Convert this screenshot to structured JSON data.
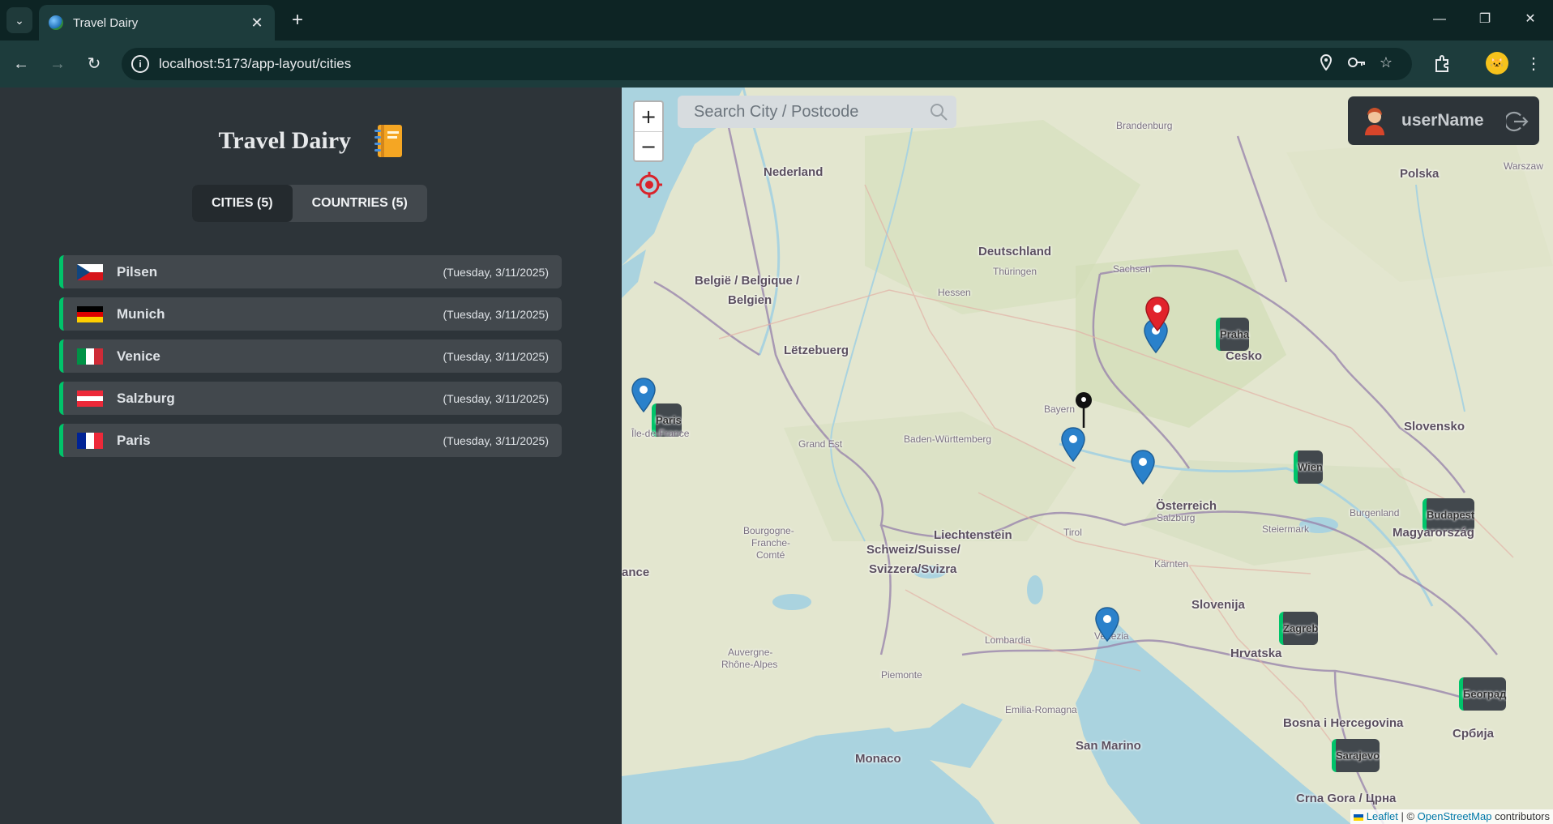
{
  "browser": {
    "tab_title": "Travel Dairy",
    "url": "localhost:5173/app-layout/cities"
  },
  "app": {
    "title": "Travel Dairy",
    "tabs": [
      {
        "label": "CITIES (5)"
      },
      {
        "label": "COUNTRIES (5)"
      }
    ],
    "cities": [
      {
        "name": "Pilsen",
        "date": "(Tuesday, 3/11/2025)",
        "flag": "cz"
      },
      {
        "name": "Munich",
        "date": "(Tuesday, 3/11/2025)",
        "flag": "de"
      },
      {
        "name": "Venice",
        "date": "(Tuesday, 3/11/2025)",
        "flag": "it"
      },
      {
        "name": "Salzburg",
        "date": "(Tuesday, 3/11/2025)",
        "flag": "at"
      },
      {
        "name": "Paris",
        "date": "(Tuesday, 3/11/2025)",
        "flag": "fr"
      }
    ]
  },
  "map": {
    "zoom_in": "+",
    "zoom_out": "−",
    "search_placeholder": "Search City / Postcode",
    "username": "userName",
    "attribution": {
      "leaflet": "Leaflet",
      "separator": "| ©",
      "osm": "OpenStreetMap",
      "suffix": "contributors"
    },
    "labels": {
      "nederland": "Nederland",
      "deutschland": "Deutschland",
      "belgie": "België / Belgique /",
      "belgien": "Belgien",
      "letzebuerg": "Lëtzebuerg",
      "cesko": "Česko",
      "praha": "Praha",
      "polska": "Polska",
      "slovensko": "Slovensko",
      "wien": "Wien",
      "osterreich": "Österreich",
      "budapest": "Budapest",
      "magyarorszag": "Magyarország",
      "liechtenstein": "Liechtenstein",
      "schweiz1": "Schweiz/Suisse/",
      "schweiz2": "Svizzera/Svizra",
      "slovenija": "Slovenija",
      "zagreb": "Zagreb",
      "hrvatska": "Hrvatska",
      "bosna": "Bosna i Hercegovina",
      "srbija": "Србија",
      "beograd": "Београд",
      "sarajevo": "Sarajevo",
      "crnagora": "Crna Gora / Црна",
      "sanmarino": "San Marino",
      "monaco": "Monaco",
      "paris": "Paris",
      "france": "ance",
      "bayern": "Bayern",
      "salzburg": "Salzburg",
      "venezia": "Venezia",
      "iledefrance": "Île-de-France",
      "grandest": "Grand Est",
      "badenw": "Baden-Württemberg",
      "hessen": "Hessen",
      "thuringen": "Thüringen",
      "sachsen": "Sachsen",
      "brandenburg": "Brandenburg",
      "lombardia": "Lombardia",
      "piemonte": "Piemonte",
      "emilia": "Emilia-Romagna",
      "auvergne": "Auvergne-",
      "rhone": "Rhône-Alpes",
      "bourgogne": "Bourgogne-",
      "franche": "Franche-",
      "comte": "Comté",
      "tirol": "Tirol",
      "karnten": "Kärnten",
      "steiermark": "Steiermark",
      "burgenland": "Burgenland",
      "warszawa": "Warszaw"
    }
  }
}
